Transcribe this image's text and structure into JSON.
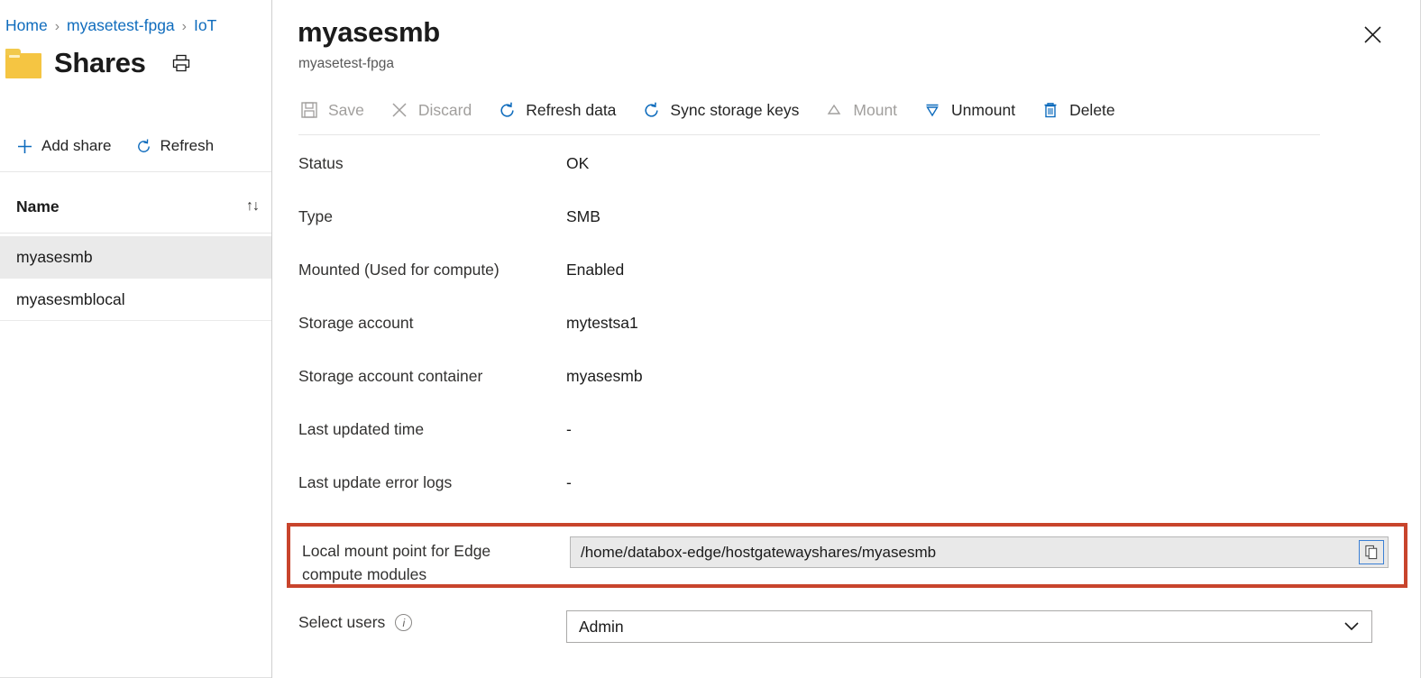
{
  "background_page": {
    "breadcrumb": {
      "items": [
        "Home",
        "myasetest-fpga",
        "IoT"
      ],
      "separator": "›"
    },
    "title": "Shares",
    "folder_icon": "folder-icon",
    "print_icon": "print-icon",
    "commands": [
      {
        "label": "Add share",
        "icon": "plus-icon"
      },
      {
        "label": "Refresh",
        "icon": "refresh-icon"
      }
    ],
    "list": {
      "column_header": "Name",
      "sort_icon": "sort-arrows-icon",
      "rows": [
        {
          "name": "myasesmb",
          "selected": true
        },
        {
          "name": "myasesmblocal",
          "selected": false
        }
      ]
    }
  },
  "blade": {
    "title": "myasesmb",
    "subtitle": "myasetest-fpga",
    "close_icon": "close-icon",
    "toolbar": [
      {
        "label": "Save",
        "icon": "save-icon",
        "disabled": true
      },
      {
        "label": "Discard",
        "icon": "discard-icon",
        "disabled": true
      },
      {
        "label": "Refresh data",
        "icon": "refresh-icon",
        "disabled": false
      },
      {
        "label": "Sync storage keys",
        "icon": "sync-icon",
        "disabled": false
      },
      {
        "label": "Mount",
        "icon": "mount-icon",
        "disabled": true
      },
      {
        "label": "Unmount",
        "icon": "unmount-icon",
        "disabled": false
      },
      {
        "label": "Delete",
        "icon": "trash-icon",
        "disabled": false
      }
    ],
    "properties": [
      {
        "label": "Status",
        "value": "OK"
      },
      {
        "label": "Type",
        "value": "SMB"
      },
      {
        "label": "Mounted (Used for compute)",
        "value": "Enabled"
      },
      {
        "label": "Storage account",
        "value": "mytestsa1"
      },
      {
        "label": "Storage account container",
        "value": "myasesmb"
      },
      {
        "label": "Last updated time",
        "value": "-"
      },
      {
        "label": "Last update error logs",
        "value": "-"
      }
    ],
    "mount_point": {
      "label": "Local mount point for Edge compute modules",
      "value": "/home/databox-edge/hostgatewayshares/myasesmb",
      "copy_icon": "copy-icon",
      "highlight_color": "#c8442c"
    },
    "select_users": {
      "label": "Select users",
      "info_icon": "info-icon",
      "value": "Admin",
      "chevron_icon": "chevron-down-icon"
    }
  },
  "colors": {
    "accent": "#0f6cbd",
    "highlight": "#c8442c",
    "folder": "#f5c542",
    "selected_row": "#eaeaea"
  }
}
